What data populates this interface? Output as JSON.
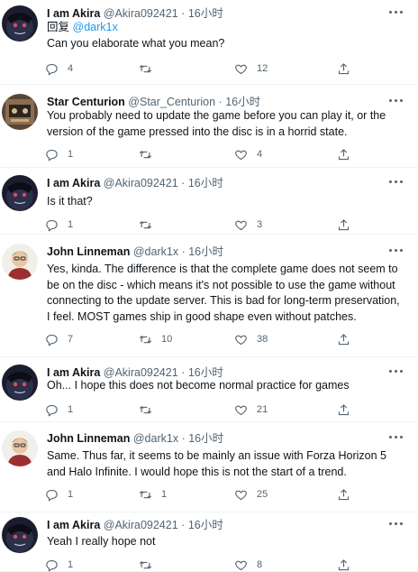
{
  "tweets": [
    {
      "name": "I am Akira",
      "handle": "@Akira092421",
      "time": "16小时",
      "reply_prefix": "回复",
      "reply_to": "@dark1x",
      "text": "Can you elaborate what you mean?",
      "replies": "4",
      "retweets": "",
      "likes": "12"
    },
    {
      "name": "Star Centurion",
      "handle": "@Star_Centurion",
      "time": "16小时",
      "text": "You probably need to update the game before you can play it, or the version of the game pressed into the disc is in a horrid state.",
      "replies": "1",
      "retweets": "",
      "likes": "4"
    },
    {
      "name": "I am Akira",
      "handle": "@Akira092421",
      "time": "16小时",
      "text": "Is it that?",
      "replies": "1",
      "retweets": "",
      "likes": "3"
    },
    {
      "name": "John Linneman",
      "handle": "@dark1x",
      "time": "16小时",
      "text": "Yes, kinda. The difference is that the complete game does not seem to be on the disc - which means it's not possible to use the game without connecting to the update server. This is bad for long-term preservation, I feel. MOST games ship in good shape even without patches.",
      "replies": "7",
      "retweets": "10",
      "likes": "38"
    },
    {
      "name": "I am Akira",
      "handle": "@Akira092421",
      "time": "16小时",
      "text": "Oh... I hope this does not become normal practice for games",
      "replies": "1",
      "retweets": "",
      "likes": "21"
    },
    {
      "name": "John Linneman",
      "handle": "@dark1x",
      "time": "16小时",
      "text": "Same. Thus far, it seems to be mainly an issue with Forza Horizon 5 and Halo Infinite. I would hope this is not the start of a trend.",
      "replies": "1",
      "retweets": "1",
      "likes": "25"
    },
    {
      "name": "I am Akira",
      "handle": "@Akira092421",
      "time": "16小时",
      "text": "Yeah I really hope not",
      "replies": "1",
      "retweets": "",
      "likes": "8"
    }
  ]
}
